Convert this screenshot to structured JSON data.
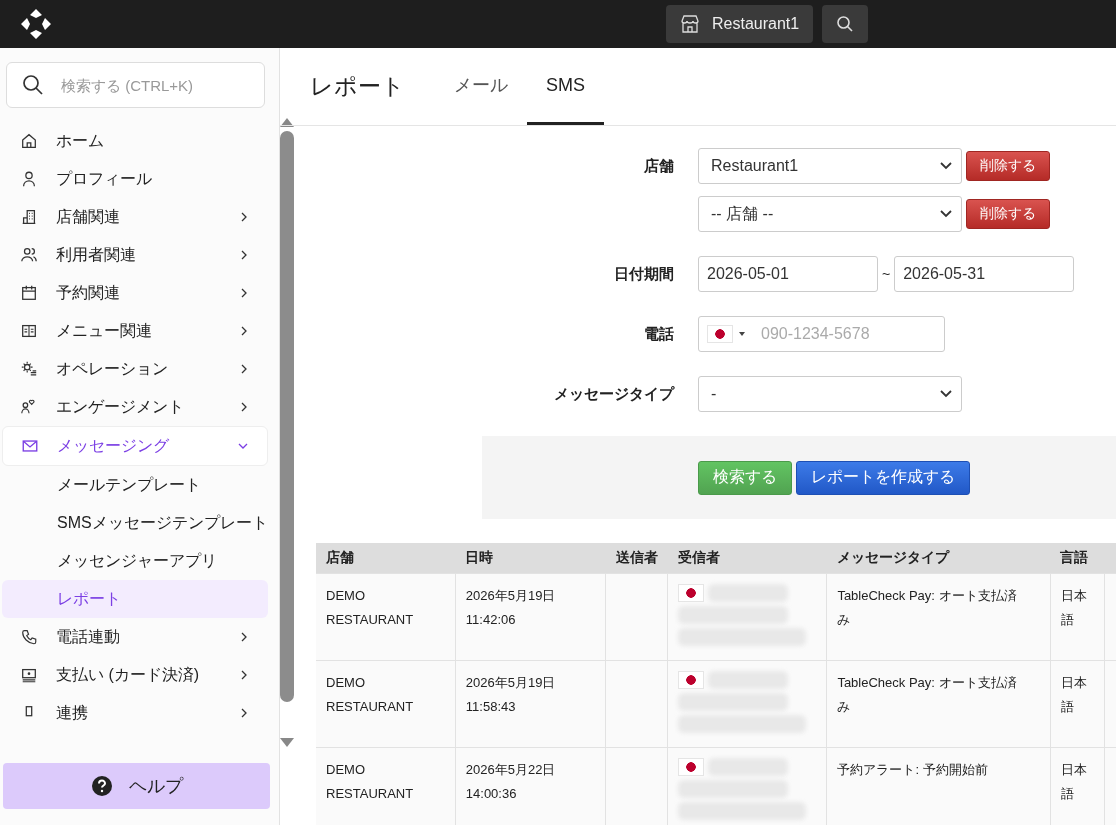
{
  "top_bar": {
    "store_button": "Restaurant1"
  },
  "sidebar": {
    "search": {
      "placeholder": "検索する (CTRL+K)"
    },
    "items": [
      {
        "label": "ホーム",
        "has_submenu": false,
        "expanded": false
      },
      {
        "label": "プロフィール",
        "has_submenu": false,
        "expanded": false
      },
      {
        "label": "店舗関連",
        "has_submenu": true,
        "expanded": false
      },
      {
        "label": "利用者関連",
        "has_submenu": true,
        "expanded": false
      },
      {
        "label": "予約関連",
        "has_submenu": true,
        "expanded": false
      },
      {
        "label": "メニュー関連",
        "has_submenu": true,
        "expanded": false
      },
      {
        "label": "オペレーション",
        "has_submenu": true,
        "expanded": false
      },
      {
        "label": "エンゲージメント",
        "has_submenu": true,
        "expanded": false
      },
      {
        "label": "メッセージング",
        "has_submenu": true,
        "expanded": true,
        "children": [
          {
            "label": "メールテンプレート",
            "selected": false
          },
          {
            "label": "SMSメッセージテンプレート",
            "selected": false
          },
          {
            "label": "メッセンジャーアプリ",
            "selected": false
          },
          {
            "label": "レポート",
            "selected": true
          }
        ]
      },
      {
        "label": "電話連動",
        "has_submenu": true,
        "expanded": false
      },
      {
        "label": "支払い (カード決済)",
        "has_submenu": true,
        "expanded": false
      },
      {
        "label": "連携",
        "has_submenu": true,
        "expanded": false
      }
    ],
    "help_button": "ヘルプ"
  },
  "header": {
    "title": "レポート",
    "tabs": [
      {
        "label": "メール",
        "selected": false
      },
      {
        "label": "SMS",
        "selected": true
      }
    ]
  },
  "form": {
    "store": {
      "label": "店舗",
      "selects": [
        {
          "value": "Restaurant1",
          "button": "削除する"
        },
        {
          "value": "-- 店舗 --",
          "button": "削除する"
        }
      ]
    },
    "date_range": {
      "label": "日付期間",
      "from": "2026-05-01",
      "separator": "~",
      "to": "2026-05-31"
    },
    "phone": {
      "label": "電話",
      "placeholder": "090-1234-5678"
    },
    "message_type": {
      "label": "メッセージタイプ",
      "value": "-"
    },
    "buttons": {
      "search": "検索する",
      "create": "レポートを作成する"
    }
  },
  "table": {
    "columns": [
      "店舗",
      "日時",
      "送信者",
      "受信者",
      "メッセージタイプ",
      "言語"
    ],
    "rows": [
      {
        "store": "DEMO RESTAURANT",
        "datetime": "2026年5月19日 11:42:06",
        "sender": "",
        "message_type": "TableCheck Pay: オート支払済み",
        "language": "日本語"
      },
      {
        "store": "DEMO RESTAURANT",
        "datetime": "2026年5月19日 11:58:43",
        "sender": "",
        "message_type": "TableCheck Pay: オート支払済み",
        "language": "日本語"
      },
      {
        "store": "DEMO RESTAURANT",
        "datetime": "2026年5月22日 14:00:36",
        "sender": "",
        "message_type": "予約アラート: 予約開始前",
        "language": "日本語"
      }
    ]
  }
}
